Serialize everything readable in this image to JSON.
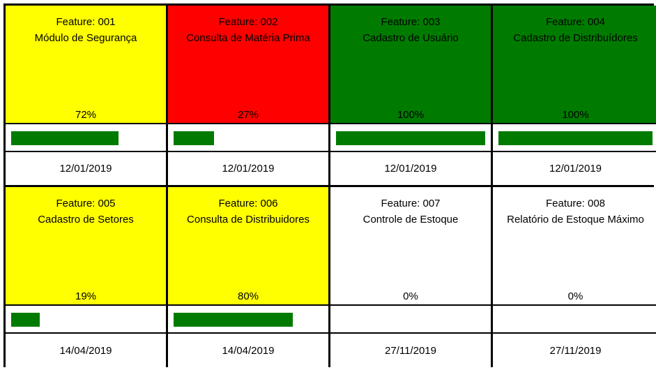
{
  "colors": {
    "yellow": "#ffff00",
    "red": "#ff0000",
    "green": "#007b00",
    "white": "#ffffff",
    "bar": "#007b00"
  },
  "features": [
    {
      "feature": "Feature: 001",
      "name": "Módulo de Segurança",
      "percent_label": "72%",
      "progress": 72,
      "date": "12/01/2019",
      "status_color": "yellow"
    },
    {
      "feature": "Feature: 002",
      "name": "Consulta de Matéria Prima",
      "percent_label": "27%",
      "progress": 27,
      "date": "12/01/2019",
      "status_color": "red"
    },
    {
      "feature": "Feature: 003",
      "name": "Cadastro de Usuário",
      "percent_label": "100%",
      "progress": 100,
      "date": "12/01/2019",
      "status_color": "green"
    },
    {
      "feature": "Feature: 004",
      "name": "Cadastro de Distribuídores",
      "percent_label": "100%",
      "progress": 100,
      "date": "12/01/2019",
      "status_color": "green"
    },
    {
      "feature": "Feature: 005",
      "name": "Cadastro de Setores",
      "percent_label": "19%",
      "progress": 19,
      "date": "14/04/2019",
      "status_color": "yellow"
    },
    {
      "feature": "Feature: 006",
      "name": "Consulta de Distribuidores",
      "percent_label": "80%",
      "progress": 80,
      "date": "14/04/2019",
      "status_color": "yellow"
    },
    {
      "feature": "Feature: 007",
      "name": "Controle de Estoque",
      "percent_label": "0%",
      "progress": 0,
      "date": "27/11/2019",
      "status_color": "white"
    },
    {
      "feature": "Feature: 008",
      "name": "Relatório de Estoque Máximo",
      "percent_label": "0%",
      "progress": 0,
      "date": "27/11/2019",
      "status_color": "white"
    }
  ]
}
